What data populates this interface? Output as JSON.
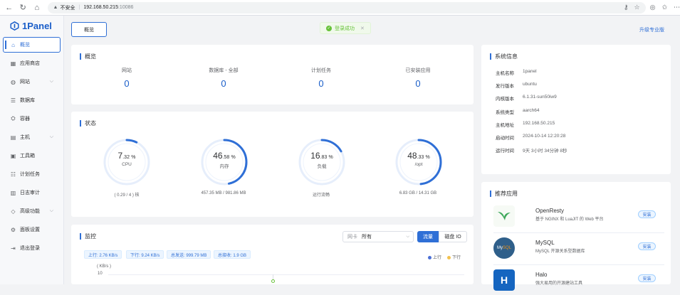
{
  "browser": {
    "security_label": "不安全",
    "url_host": "192.168.50.215",
    "url_port": ":10086"
  },
  "sidebar": {
    "brand": "1Panel",
    "items": [
      {
        "label": "概览",
        "icon": "home-icon",
        "active": true
      },
      {
        "label": "应用商店",
        "icon": "grid-icon"
      },
      {
        "label": "网站",
        "icon": "globe-icon",
        "expandable": true
      },
      {
        "label": "数据库",
        "icon": "database-icon"
      },
      {
        "label": "容器",
        "icon": "container-icon"
      },
      {
        "label": "主机",
        "icon": "server-icon",
        "expandable": true
      },
      {
        "label": "工具箱",
        "icon": "toolbox-icon"
      },
      {
        "label": "计划任务",
        "icon": "schedule-icon"
      },
      {
        "label": "日志审计",
        "icon": "log-icon"
      },
      {
        "label": "高级功能",
        "icon": "diamond-icon",
        "expandable": true
      },
      {
        "label": "面板设置",
        "icon": "settings-icon"
      },
      {
        "label": "退出登录",
        "icon": "logout-icon"
      }
    ]
  },
  "header": {
    "tab_label": "概览",
    "upgrade_label": "升级专业版",
    "toast_text": "登录成功"
  },
  "overview": {
    "title": "概览",
    "stats": [
      {
        "label": "网站",
        "value": "0"
      },
      {
        "label": "数据库 - 全部",
        "value": "0"
      },
      {
        "label": "计划任务",
        "value": "0"
      },
      {
        "label": "已安装应用",
        "value": "0"
      }
    ]
  },
  "status": {
    "title": "状态",
    "gauges": [
      {
        "int": "7",
        "dec": ".32",
        "unit": "%",
        "name": "CPU",
        "percent": 7.32,
        "footer": "( 0.29 / 4 ) 核"
      },
      {
        "int": "46",
        "dec": ".58",
        "unit": "%",
        "name": "内存",
        "percent": 46.58,
        "footer": "457.35 MB / 981.86 MB"
      },
      {
        "int": "16",
        "dec": ".83",
        "unit": "%",
        "name": "负载",
        "percent": 16.83,
        "footer": "运行流畅"
      },
      {
        "int": "48",
        "dec": ".33",
        "unit": "%",
        "name": "/opt",
        "percent": 48.33,
        "footer": "6.83 GB / 14.31 GB"
      }
    ]
  },
  "monitor": {
    "title": "监控",
    "nic_prefix": "网卡",
    "nic_value": "所有",
    "seg_traffic": "流量",
    "seg_disk": "磁盘 IO",
    "tags": [
      "上行: 2.76 KB/s",
      "下行: 9.24 KB/s",
      "总发送: 999.79 MB",
      "总接收: 1.9 GB"
    ],
    "legend": [
      {
        "label": "上行",
        "color": "#4b6fd6"
      },
      {
        "label": "下行",
        "color": "#f2c14e"
      }
    ],
    "y_unit": "( KB/s )",
    "y_tick": "10"
  },
  "sysinfo": {
    "title": "系统信息",
    "rows": [
      {
        "k": "主机名称",
        "v": "1panel"
      },
      {
        "k": "发行版本",
        "v": "ubuntu"
      },
      {
        "k": "内核版本",
        "v": "6.1.31-sun50iw9"
      },
      {
        "k": "系统类型",
        "v": "aarch64"
      },
      {
        "k": "主机地址",
        "v": "192.168.50.215"
      },
      {
        "k": "启动时间",
        "v": "2024-10-14 12:20:28"
      },
      {
        "k": "运行时间",
        "v": "9天 3小时 34分钟 8秒"
      }
    ]
  },
  "apps": {
    "title": "推荐应用",
    "install_label": "安装",
    "items": [
      {
        "name": "OpenResty",
        "desc": "基于 NGINX 和 LuaJIT 的 Web 平台",
        "color": "#3ea85b"
      },
      {
        "name": "MySQL",
        "desc": "MySQL 开源关系型数据库",
        "color": "#2f5f8a"
      },
      {
        "name": "Halo",
        "desc": "强大易用的开源建站工具",
        "color": "#1565c0"
      }
    ]
  },
  "colors": {
    "accent": "#2f6fd6",
    "success": "#67c23a"
  }
}
